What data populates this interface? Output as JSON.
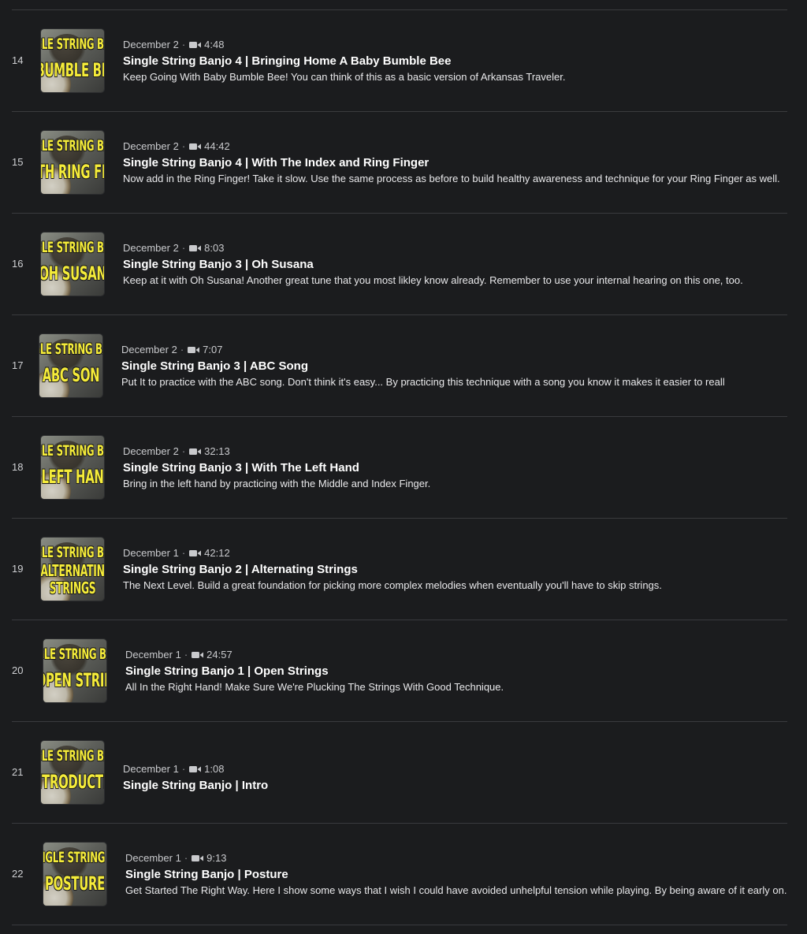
{
  "lessons": [
    {
      "number": "14",
      "date": "December 2",
      "duration": "4:48",
      "title": "Single String Banjo 4 | Bringing Home A Baby Bumble Bee",
      "description": "Keep Going With Baby Bumble Bee! You can think of this as a basic version of Arkansas Traveler.",
      "thumb_top": "GLE STRING BA",
      "thumb_main": "BUMBLE BE",
      "thumb_extra": ""
    },
    {
      "number": "15",
      "date": "December 2",
      "duration": "44:42",
      "title": "Single String Banjo 4 | With The Index and Ring Finger",
      "description": "Now add in the Ring Finger! Take it slow. Use the same process as before to build healthy awareness and technique for your Ring Finger as well.",
      "thumb_top": "GLE STRING BA",
      "thumb_main": "WITH RING FING",
      "thumb_extra": ""
    },
    {
      "number": "16",
      "date": "December 2",
      "duration": "8:03",
      "title": "Single String Banjo 3 | Oh Susana",
      "description": "Keep at it with Oh Susana! Another great tune that you most likley know already. Remember to use your internal hearing on this one, too.",
      "thumb_top": "GLE STRING BA",
      "thumb_main": "OH SUSAN",
      "thumb_extra": ""
    },
    {
      "number": "17",
      "date": "December 2",
      "duration": "7:07",
      "title": "Single String Banjo 3 | ABC Song",
      "description": "Put It to practice with the ABC song. Don't think it's easy... By practicing this technique with a song you know it makes it easier to reall",
      "thumb_top": "GLE STRING BA",
      "thumb_main": "ABC SON",
      "thumb_extra": ""
    },
    {
      "number": "18",
      "date": "December 2",
      "duration": "32:13",
      "title": "Single String Banjo 3 | With The Left Hand",
      "description": "Bring in the left hand by practicing with the Middle and Index Finger.",
      "thumb_top": "GLE STRING BA",
      "thumb_main": "LEFT HAN",
      "thumb_extra": ""
    },
    {
      "number": "19",
      "date": "December 1",
      "duration": "42:12",
      "title": "Single String Banjo 2 | Alternating Strings",
      "description": "The Next Level. Build a great foundation for picking more complex melodies when eventually you'll have to skip strings.",
      "thumb_top": "GLE STRING BA",
      "thumb_main": "ALTERNATIN",
      "thumb_extra": "STRINGS"
    },
    {
      "number": "20",
      "date": "December 1",
      "duration": "24:57",
      "title": "Single String Banjo 1 | Open Strings",
      "description": "All In the Right Hand! Make Sure We're Plucking The Strings With Good Technique.",
      "thumb_top": "GLE STRING BA",
      "thumb_main": "OPEN STRIN",
      "thumb_extra": ""
    },
    {
      "number": "21",
      "date": "December 1",
      "duration": "1:08",
      "title": "Single String Banjo | Intro",
      "description": "",
      "thumb_top": "GLE STRING BA",
      "thumb_main": "INTRODUCTIO",
      "thumb_extra": ""
    },
    {
      "number": "22",
      "date": "December 1",
      "duration": "9:13",
      "title": "Single String Banjo | Posture",
      "description": "Get Started The Right Way. Here I show some ways that I wish I could have avoided unhelpful tension while playing. By being aware of it early on.",
      "thumb_top": "SINGLE STRING BA",
      "thumb_main": "POSTURE",
      "thumb_extra": ""
    }
  ],
  "colors": {
    "background": "#1b1c1e",
    "divider": "#3a3b3e",
    "thumb_text": "#f5ec3a"
  },
  "icons": {
    "meta_icon": "video-camera-icon"
  }
}
